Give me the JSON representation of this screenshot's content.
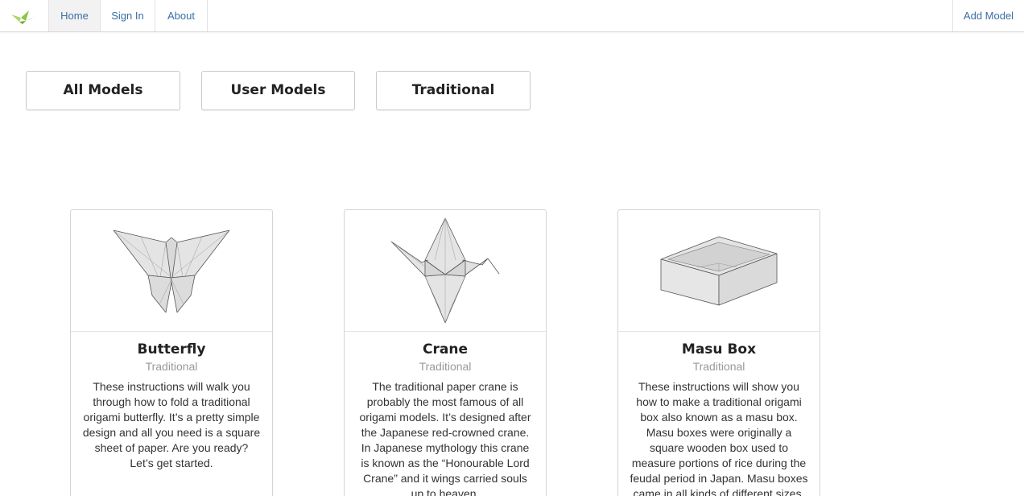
{
  "nav": {
    "logo_icon": "origami-crane-logo-icon",
    "items": [
      {
        "label": "Home",
        "active": true
      },
      {
        "label": "Sign In"
      },
      {
        "label": "About"
      }
    ],
    "add_model": "Add Model"
  },
  "filters": [
    {
      "label": "All Models"
    },
    {
      "label": "User Models"
    },
    {
      "label": "Traditional"
    }
  ],
  "cards": [
    {
      "icon": "butterfly-icon",
      "title": "Butterfly",
      "category": "Traditional",
      "description": "These instructions will walk you through how to fold a traditional origami butterfly. It’s a pretty simple design and all you need is a square sheet of paper. Are you ready? Let’s get started."
    },
    {
      "icon": "crane-icon",
      "title": "Crane",
      "category": "Traditional",
      "description": "The traditional paper crane is probably the most famous of all origami models. It’s designed after the Japanese red-crowned crane. In Japanese mythology this crane is known as the “Honourable Lord Crane” and it wings carried souls up to heaven."
    },
    {
      "icon": "masu-box-icon",
      "title": "Masu Box",
      "category": "Traditional",
      "description": "These instructions will show you how to make a traditional origami box also known as a masu box. Masu boxes were originally a square wooden box used to measure portions of rice during the feudal period in Japan. Masu boxes came in all kinds of different sizes."
    }
  ],
  "colors": {
    "link": "#3a6ea5",
    "logo_green": "#8cc63f",
    "paper": "#e4e4e4"
  }
}
